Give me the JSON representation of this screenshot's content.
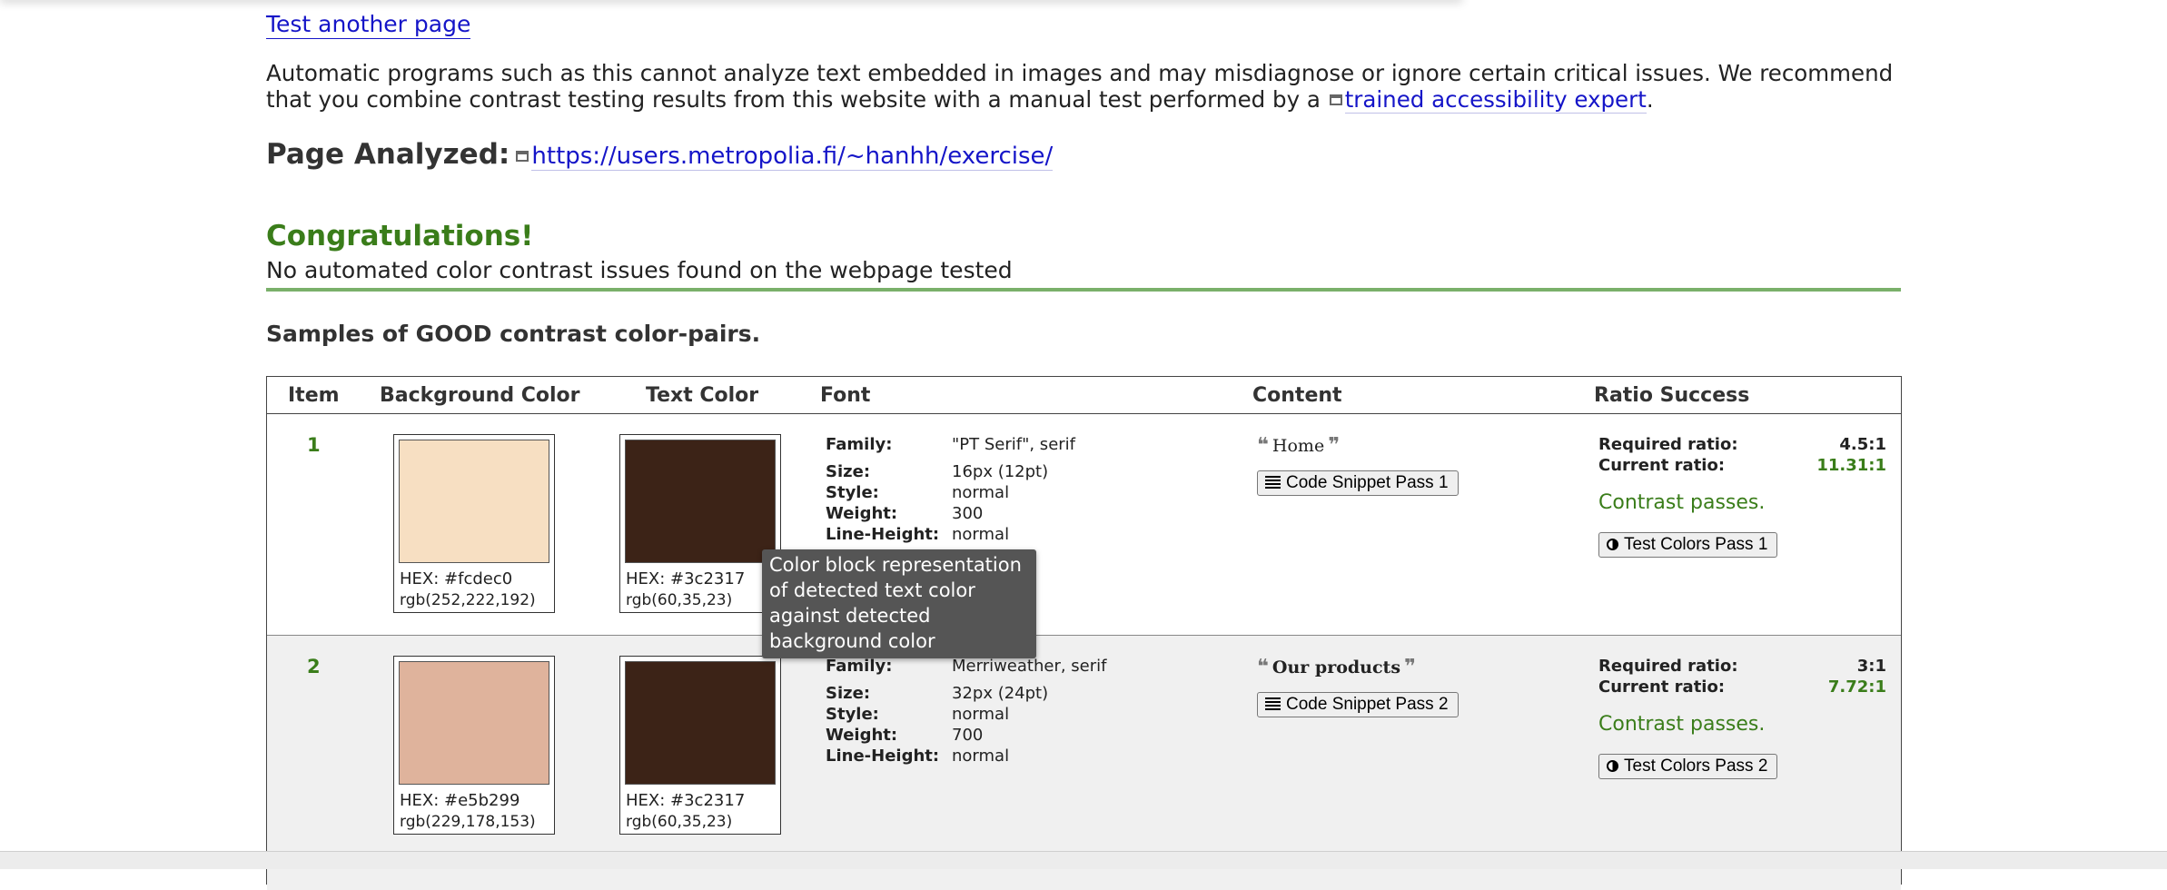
{
  "nav": {
    "test_another_page": "Test another page"
  },
  "disclaimer": {
    "text": "Automatic programs such as this cannot analyze text embedded in images and may misdiagnose or ignore certain critical issues. We recommend that you combine contrast testing results from this website with a manual test performed by a",
    "link": "trained accessibility expert",
    "end": "."
  },
  "page_analyzed": {
    "label": "Page Analyzed:",
    "url": "https://users.metropolia.fi/~hanhh/exercise/"
  },
  "result": {
    "title": "Congratulations!",
    "message": "No automated color contrast issues found on the webpage tested",
    "color": "#3a7d1a"
  },
  "samples_heading": "Samples of GOOD contrast color-pairs.",
  "table": {
    "headers": {
      "item": "Item",
      "background": "Background Color",
      "text": "Text Color",
      "font": "Font",
      "content": "Content",
      "ratio": "Ratio Success"
    },
    "font_labels": {
      "family": "Family:",
      "size": "Size:",
      "style": "Style:",
      "weight": "Weight:",
      "line_height": "Line-Height:"
    },
    "ratio_labels": {
      "required": "Required ratio:",
      "current": "Current ratio:"
    },
    "rows": [
      {
        "item": "1",
        "bg": {
          "hex_label": "HEX: #fcdec0",
          "rgb": "rgb(252,222,192)",
          "color": "#f7dfc2"
        },
        "fg": {
          "hex_label": "HEX: #3c2317",
          "rgb": "rgb(60,35,23)",
          "color": "#3c2317"
        },
        "font": {
          "family": "\"PT Serif\", serif",
          "size": "16px (12pt)",
          "style": "normal",
          "weight": "300",
          "line_height": "normal"
        },
        "content": {
          "text": "Home",
          "button": "Code Snippet Pass 1"
        },
        "ratio": {
          "required": "4.5:1",
          "current": "11.31:1",
          "status": "Contrast passes.",
          "button": "Test Colors Pass 1"
        }
      },
      {
        "item": "2",
        "bg": {
          "hex_label": "HEX: #e5b299",
          "rgb": "rgb(229,178,153)",
          "color": "#dfb39c"
        },
        "fg": {
          "hex_label": "HEX: #3c2317",
          "rgb": "rgb(60,35,23)",
          "color": "#3c2317"
        },
        "font": {
          "family": "Merriweather, serif",
          "size": "32px (24pt)",
          "style": "normal",
          "weight": "700",
          "line_height": "normal"
        },
        "content": {
          "text": "Our products",
          "button": "Code Snippet Pass 2"
        },
        "ratio": {
          "required": "3:1",
          "current": "7.72:1",
          "status": "Contrast passes.",
          "button": "Test Colors Pass 2"
        }
      }
    ]
  },
  "tooltip": {
    "text": "Color block representation of detected text color against detected background color"
  },
  "icons": {
    "external": "external-link-icon",
    "quote_open": "quote-open-icon",
    "quote_close": "quote-close-icon",
    "snippet": "lines-icon",
    "contrast": "contrast-icon"
  }
}
